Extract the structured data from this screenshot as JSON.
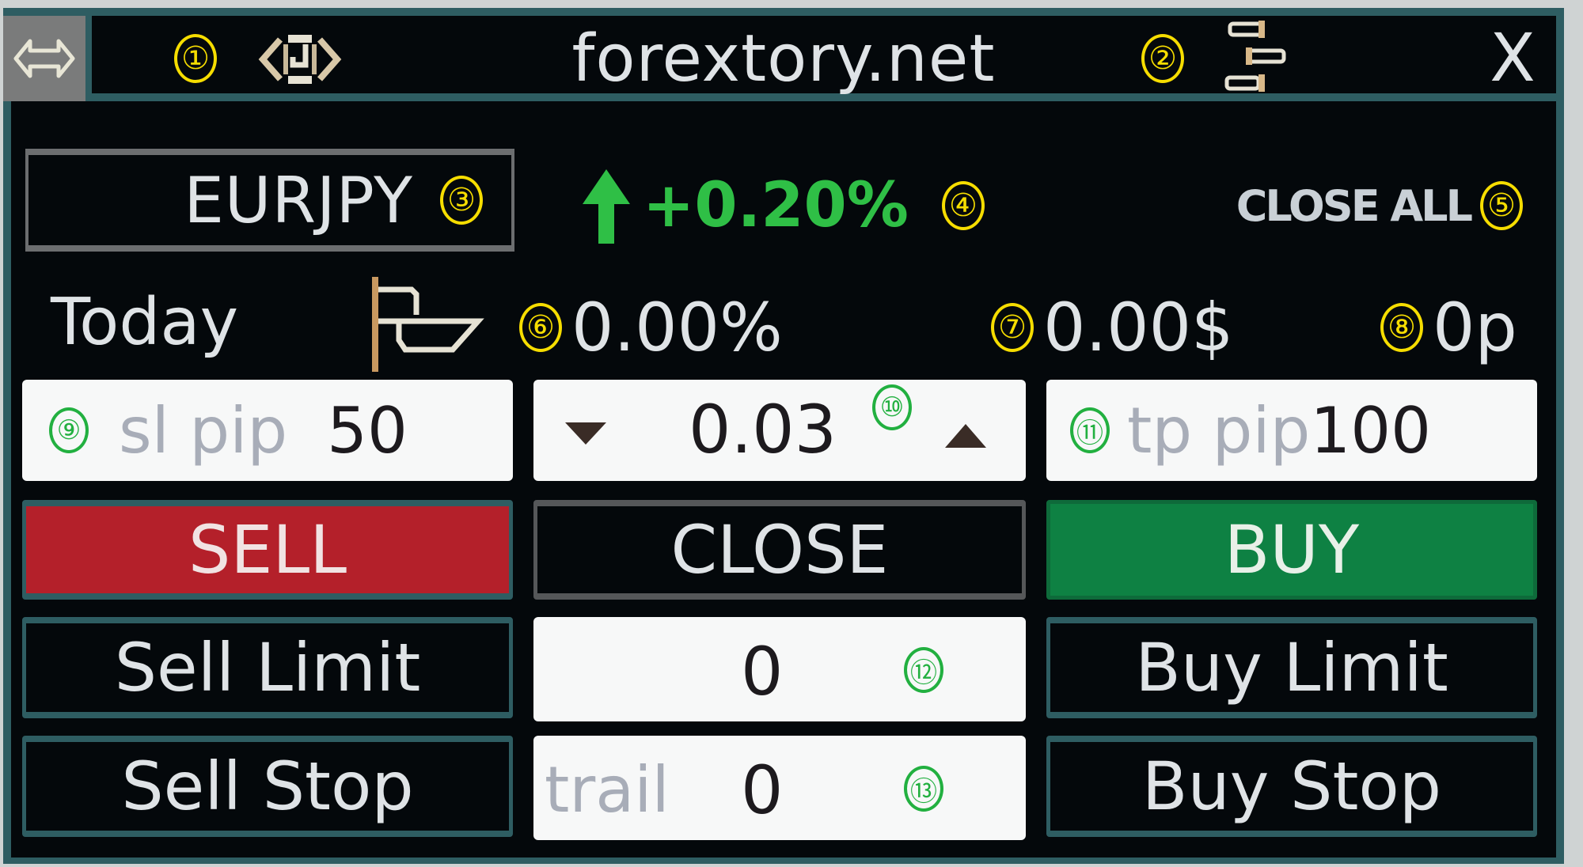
{
  "header": {
    "title": "forextory.net",
    "move_handle_icon": "double-arrow-icon",
    "sync_icon": "sync-icon",
    "settings_icon": "stacked-toggles-icon",
    "close_label": "X",
    "annotations": [
      "①",
      "②"
    ]
  },
  "symbol": {
    "value": "EURJPY",
    "annotation": "③"
  },
  "daily_change": {
    "direction_icon": "arrow-up-icon",
    "value": "+0.20%",
    "color": "#2fbf46",
    "annotation": "④"
  },
  "close_all": {
    "label": "CLOSE ALL",
    "annotation": "⑤"
  },
  "today": {
    "label": "Today",
    "period_icon": "flag-icon",
    "profit_percent": "0.00%",
    "profit_money": "0.00$",
    "profit_pips": "0p",
    "annotations": [
      "⑥",
      "⑦",
      "⑧"
    ]
  },
  "inputs": {
    "sl": {
      "placeholder": "sl pip",
      "value": "50",
      "annotation": "⑨"
    },
    "lot": {
      "value": "0.03",
      "annotation": "⑩"
    },
    "tp": {
      "placeholder": "tp pip",
      "value": "100",
      "annotation": "⑪"
    },
    "pending_price": {
      "value": "0",
      "annotation": "⑫"
    },
    "trail": {
      "placeholder": "trail",
      "value": "0",
      "annotation": "⑬"
    }
  },
  "buttons": {
    "sell": "SELL",
    "close": "CLOSE",
    "buy": "BUY",
    "sell_limit": "Sell Limit",
    "buy_limit": "Buy Limit",
    "sell_stop": "Sell Stop",
    "buy_stop": "Buy Stop"
  },
  "colors": {
    "sell": "#b4202a",
    "buy": "#0e8143",
    "frame": "#2e5d62",
    "annotation_yellow": "#f6dd00",
    "annotation_green": "#22b040"
  }
}
